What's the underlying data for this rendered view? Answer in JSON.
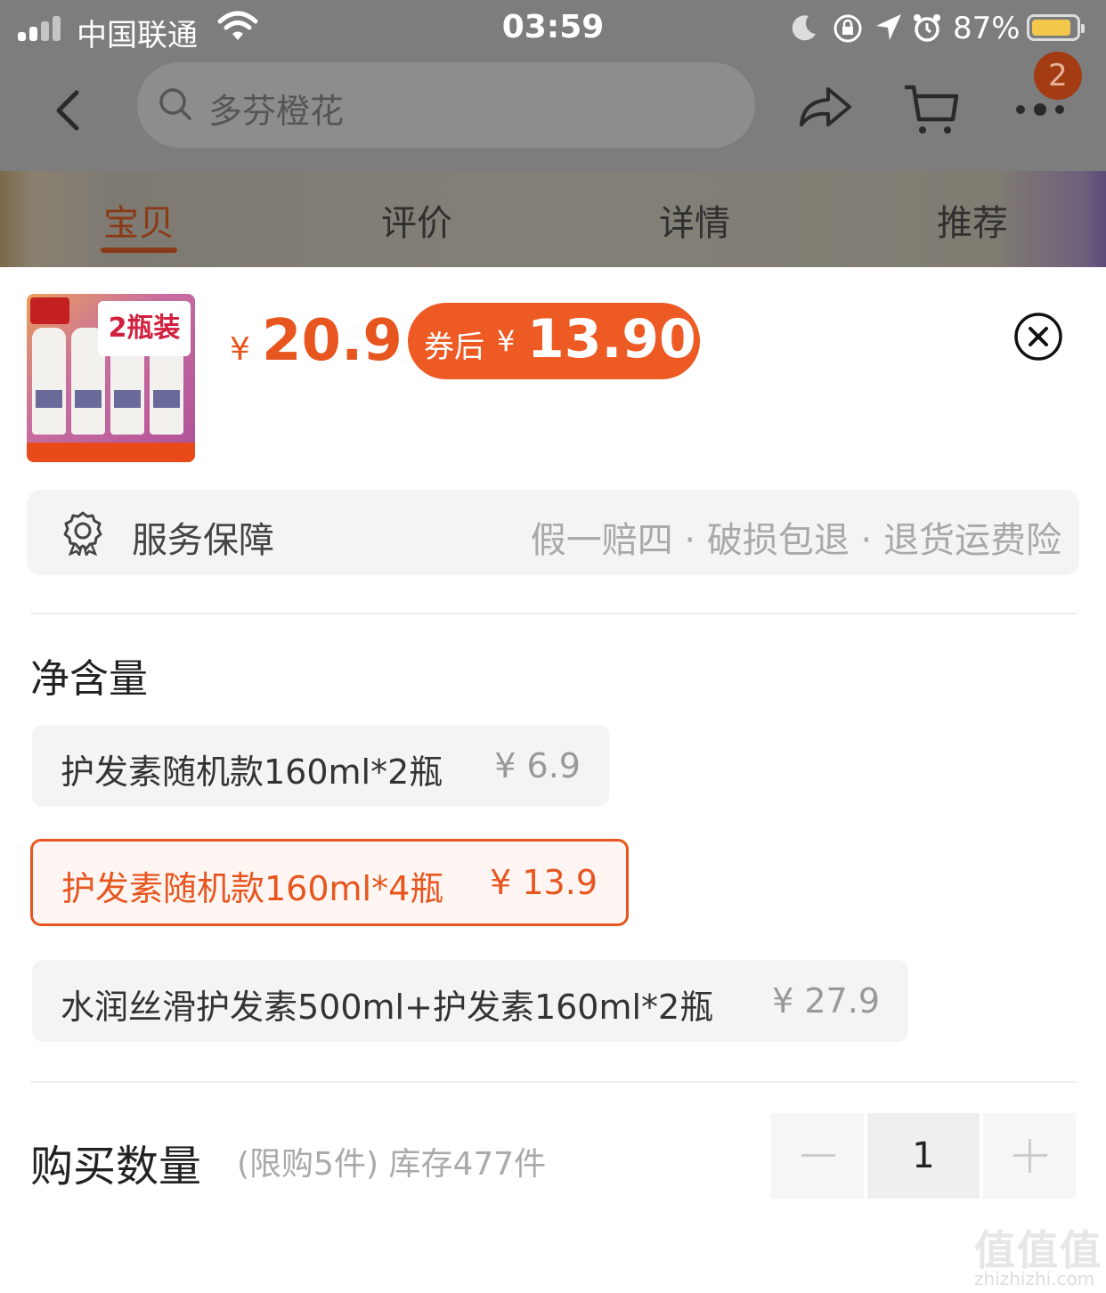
{
  "status_bar": {
    "carrier": "中国联通",
    "time": "03:59",
    "battery": "87%"
  },
  "nav": {
    "search_placeholder": "多芬橙花",
    "badge": "2"
  },
  "tabs": [
    {
      "label": "宝贝",
      "active": true
    },
    {
      "label": "评价"
    },
    {
      "label": "详情"
    },
    {
      "label": "推荐"
    }
  ],
  "product": {
    "thumb_tag": "2瓶装",
    "price_symbol": "¥",
    "price": "20.9",
    "coupon_label": "券后",
    "coupon_symbol": "¥",
    "coupon_price": "13.90"
  },
  "service": {
    "title": "服务保障",
    "desc": "假一赔四 · 破损包退 · 退货运费险"
  },
  "spec": {
    "title": "净含量",
    "options": [
      {
        "name": "护发素随机款160ml*2瓶",
        "price": "¥ 6.9",
        "selected": false
      },
      {
        "name": "护发素随机款160ml*4瓶",
        "price": "¥ 13.9",
        "selected": true
      },
      {
        "name": "水润丝滑护发素500ml+护发素160ml*2瓶",
        "price": "¥ 27.9",
        "selected": false
      }
    ]
  },
  "quantity": {
    "title": "购买数量",
    "limit": "(限购5件) 库存477件",
    "value": "1"
  },
  "watermark": {
    "main": "值值值",
    "sub": "zhizhizhi.com"
  },
  "colors": {
    "accent": "#e8561f",
    "coupon_bg": "#ee5a24"
  }
}
